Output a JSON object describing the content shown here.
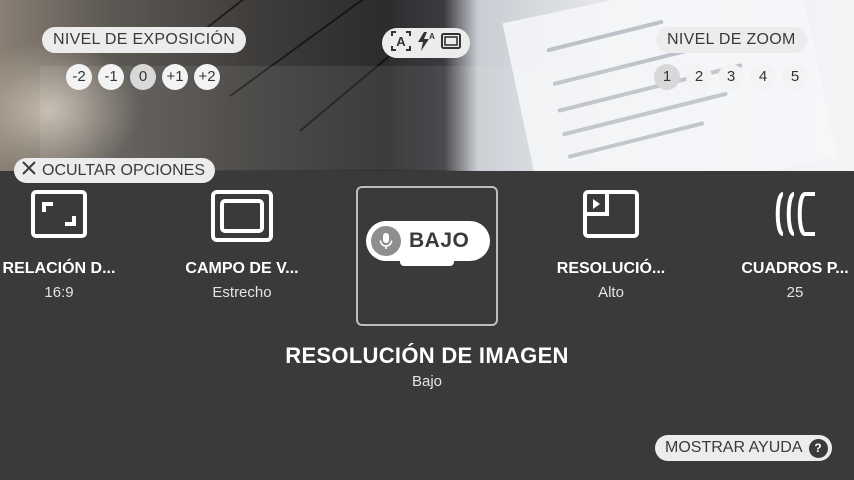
{
  "viewfinder": {
    "exposure": {
      "label": "NIVEL DE EXPOSICIÓN",
      "values": [
        "-2",
        "-1",
        "0",
        "+1",
        "+2"
      ],
      "selected": "0"
    },
    "zoom": {
      "label": "NIVEL DE ZOOM",
      "values": [
        "1",
        "2",
        "3",
        "4",
        "5"
      ],
      "selected": "1"
    },
    "quick_icons": [
      "text-recognition-icon",
      "flash-auto-icon",
      "aspect-frame-icon"
    ]
  },
  "hide_options": {
    "label": "OCULTAR OPCIONES",
    "icon": "close-icon"
  },
  "options": [
    {
      "name": "RELACIÓN D...",
      "value": "16:9",
      "icon": "aspect-ratio-icon"
    },
    {
      "name": "CAMPO DE V...",
      "value": "Estrecho",
      "icon": "field-of-view-icon"
    },
    {
      "name": "RESOLUCIÓN DE IMAGEN",
      "value": "Bajo",
      "icon": "microphone-icon",
      "selected": true
    },
    {
      "name": "RESOLUCIÓ...",
      "value": "Alto",
      "icon": "video-resolution-icon"
    },
    {
      "name": "CUADROS P...",
      "value": "25",
      "icon": "frame-rate-icon"
    }
  ],
  "selected_option": {
    "title": "RESOLUCIÓN DE IMAGEN",
    "value": "Bajo",
    "pill_label": "BAJO"
  },
  "help": {
    "label": "MOSTRAR AYUDA",
    "icon_glyph": "?"
  },
  "colors": {
    "panel": "#3a3a3a",
    "pill": "#ececec",
    "text": "#ffffff"
  }
}
